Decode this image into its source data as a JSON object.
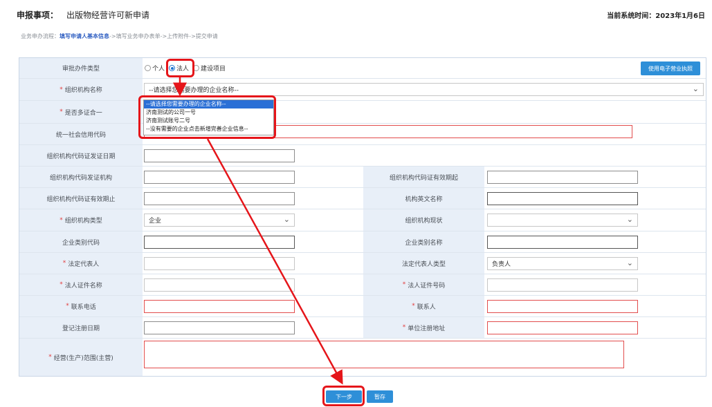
{
  "header": {
    "title_key": "申报事项：",
    "title_value": "出版物经营许可新申请",
    "time_label": "当前系统时间：",
    "time_value": "2023年1月6日"
  },
  "crumbs": {
    "prefix": "业务申办流程：",
    "step1": "填写申请人基本信息",
    "rest": "->填写业务申办表单->上传附件->提交申请"
  },
  "form": {
    "approval_type": {
      "label": "审批办件类型",
      "options": [
        "个人",
        "法人",
        "建设项目"
      ],
      "selected": "法人"
    },
    "license_button": "使用电子营业执照",
    "org_name": {
      "label": "组织机构名称",
      "placeholder": "--请选择您需要办理的企业名称--",
      "dropdown_options": [
        "--请选择您需要办理的企业名称--",
        "济南测试的公司一号",
        "济南测试账号二号",
        "--没有需要的企业点击新增完善企业信息--"
      ]
    },
    "multi_cert": {
      "label": "是否多证合一"
    },
    "credit_code": {
      "label": "统一社会信用代码"
    },
    "org_code_date": {
      "label": "组织机构代码证发证日期"
    },
    "org_code_issuer": {
      "label": "组织机构代码发证机构"
    },
    "org_code_valid_from": {
      "label": "组织机构代码证有效期起"
    },
    "org_code_valid_to": {
      "label": "组织机构代码证有效期止"
    },
    "org_en_name": {
      "label": "机构英文名称"
    },
    "org_type": {
      "label": "组织机构类型",
      "value": "企业"
    },
    "org_status": {
      "label": "组织机构现状",
      "value": ""
    },
    "ent_category_code": {
      "label": "企业类别代码"
    },
    "ent_category_name": {
      "label": "企业类别名称"
    },
    "legal_rep": {
      "label": "法定代表人"
    },
    "legal_rep_type": {
      "label": "法定代表人类型",
      "value": "负责人"
    },
    "legal_id_name": {
      "label": "法人证件名称"
    },
    "legal_id_no": {
      "label": "法人证件号码"
    },
    "phone": {
      "label": "联系电话"
    },
    "contact": {
      "label": "联系人"
    },
    "reg_date": {
      "label": "登记注册日期"
    },
    "reg_address": {
      "label": "单位注册地址"
    },
    "scope": {
      "label": "经营(生产)范围(主营)"
    }
  },
  "buttons": {
    "next": "下一步",
    "save": "暂存"
  },
  "colors": {
    "accent": "#2e8fd8",
    "highlight": "#e5151a",
    "label_bg": "#e8eff8",
    "error_border": "#e24c4c"
  }
}
